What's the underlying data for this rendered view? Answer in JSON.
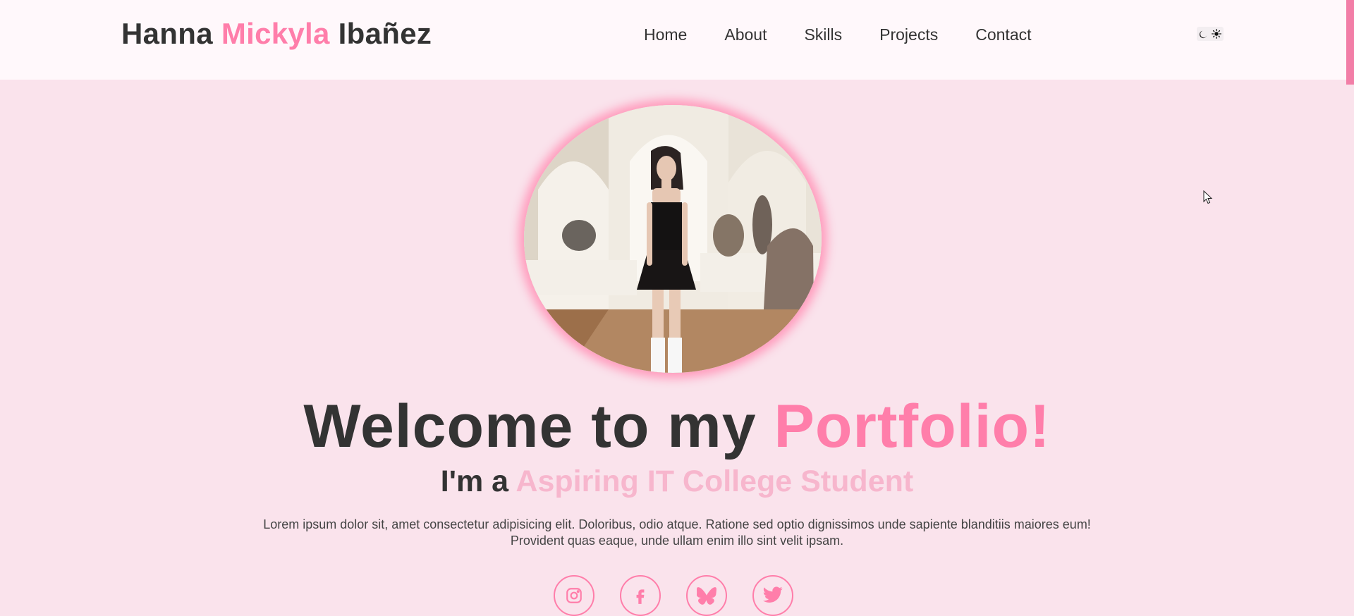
{
  "header": {
    "logo_first": "Hanna ",
    "logo_middle": "Mickyla",
    "logo_last": " Ibañez",
    "nav": [
      {
        "label": "Home"
      },
      {
        "label": "About"
      },
      {
        "label": "Skills"
      },
      {
        "label": "Projects"
      },
      {
        "label": "Contact"
      }
    ],
    "theme_toggle": {
      "icons": [
        "moon-icon",
        "sun-icon"
      ]
    }
  },
  "hero": {
    "profile_image": "photo of a woman in a black strapless dress and white knee socks in a white arched room with rocks",
    "title_main": "Welcome to my ",
    "title_accent": "Portfolio!",
    "subtitle_prefix": "I'm a ",
    "subtitle_role": "Aspiring IT College Student",
    "description_line1": "Lorem ipsum dolor sit, amet consectetur adipisicing elit. Doloribus, odio atque. Ratione sed optio dignissimos unde sapiente blanditiis maiores eum!",
    "description_line2": "Provident quas eaque, unde ullam enim illo sint velit ipsam.",
    "socials": [
      "instagram-icon",
      "facebook-icon",
      "bluesky-icon",
      "twitter-icon"
    ]
  },
  "colors": {
    "accent": "#ff7eaa",
    "accent_light": "#f7b6cd",
    "background": "#fae3ec",
    "header_bg": "#fff8fb",
    "text": "#333333"
  }
}
